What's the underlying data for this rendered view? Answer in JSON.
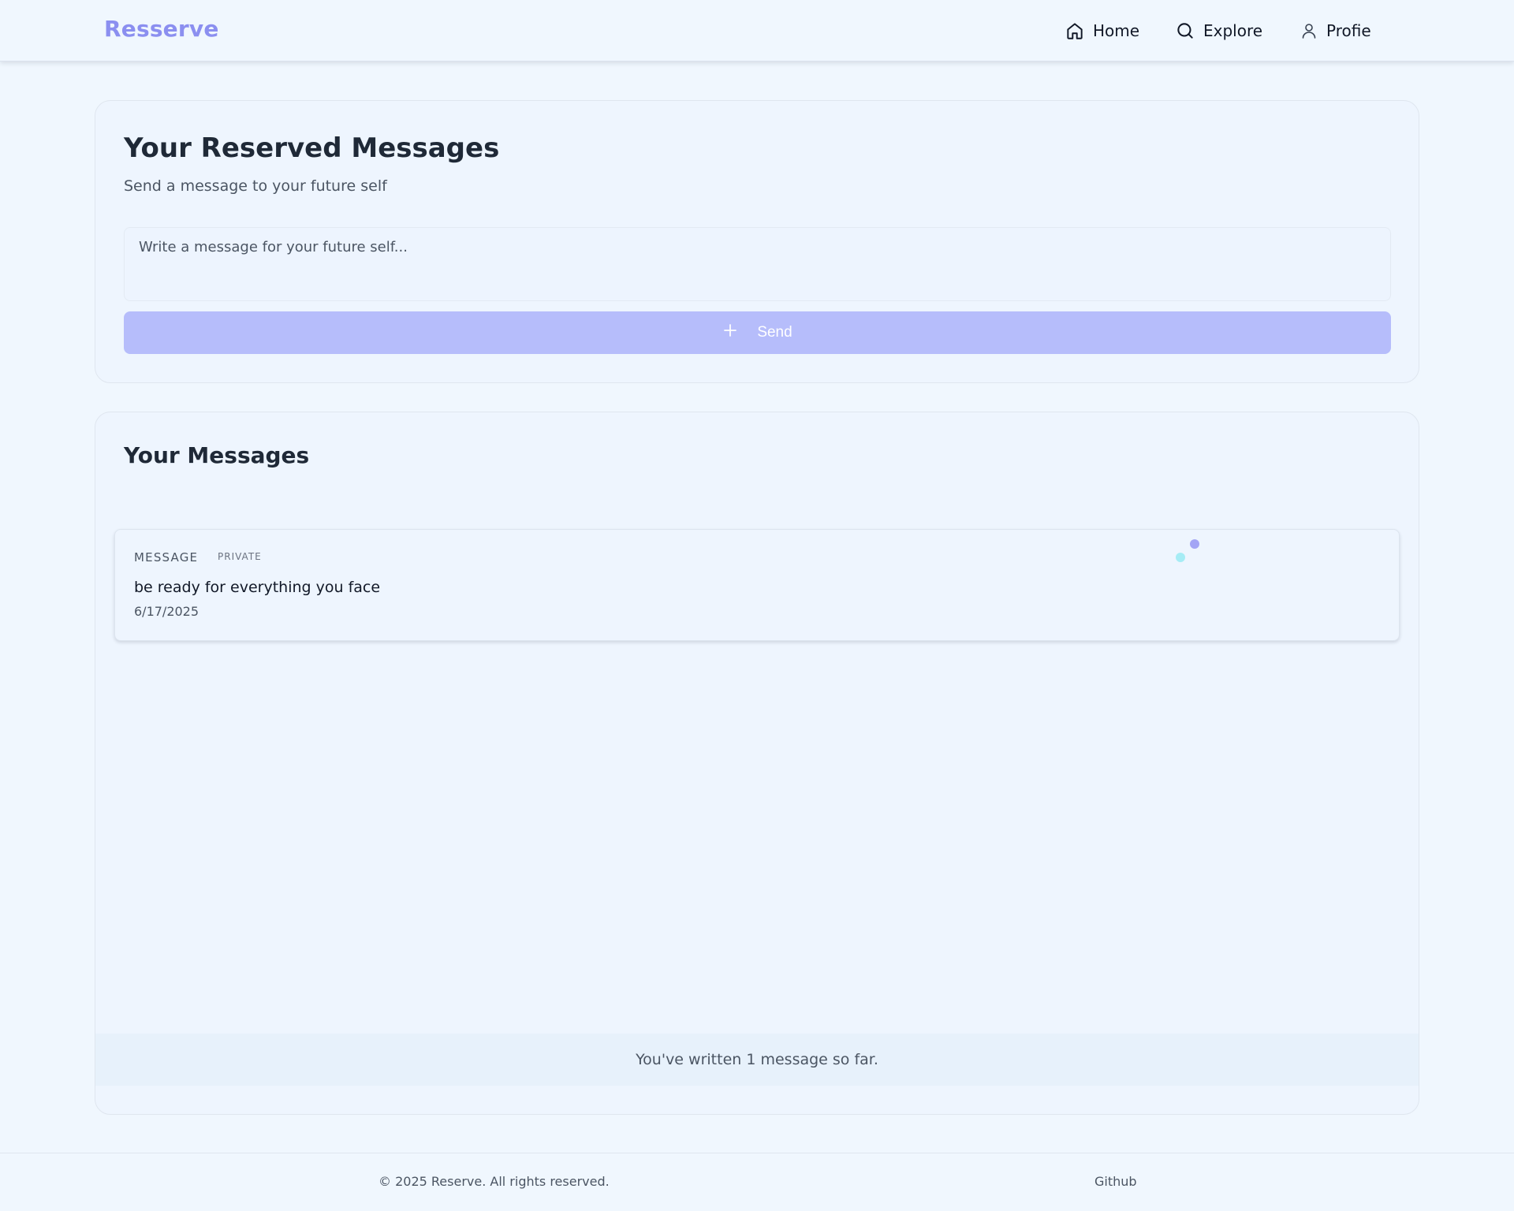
{
  "header": {
    "logo": "Resserve",
    "nav": {
      "home": "Home",
      "explore": "Explore",
      "profile": "Profie"
    }
  },
  "compose": {
    "title": "Your Reserved Messages",
    "subtitle": "Send a message to your future self",
    "input_value": "",
    "input_placeholder": "Write a message for your future self...",
    "send_label": "Send"
  },
  "messages": {
    "title": "Your Messages",
    "items": [
      {
        "type": "MESSAGE",
        "visibility": "PRIVATE",
        "text": "be ready for everything you face",
        "date": "6/17/2025"
      }
    ],
    "count_text": "You've written 1 message so far."
  },
  "footer": {
    "copyright": "© 2025 Reserve. All rights reserved.",
    "github": "Github"
  },
  "colors": {
    "brand": "#8b8ff0",
    "button": "#b6bdfb",
    "background": "#f0f7fe",
    "dot_purple": "#a3a5f5",
    "dot_cyan": "#a6ecf5"
  },
  "icons": {
    "home": "home-icon",
    "explore": "search-icon",
    "profile": "user-icon",
    "send": "plus-icon"
  }
}
